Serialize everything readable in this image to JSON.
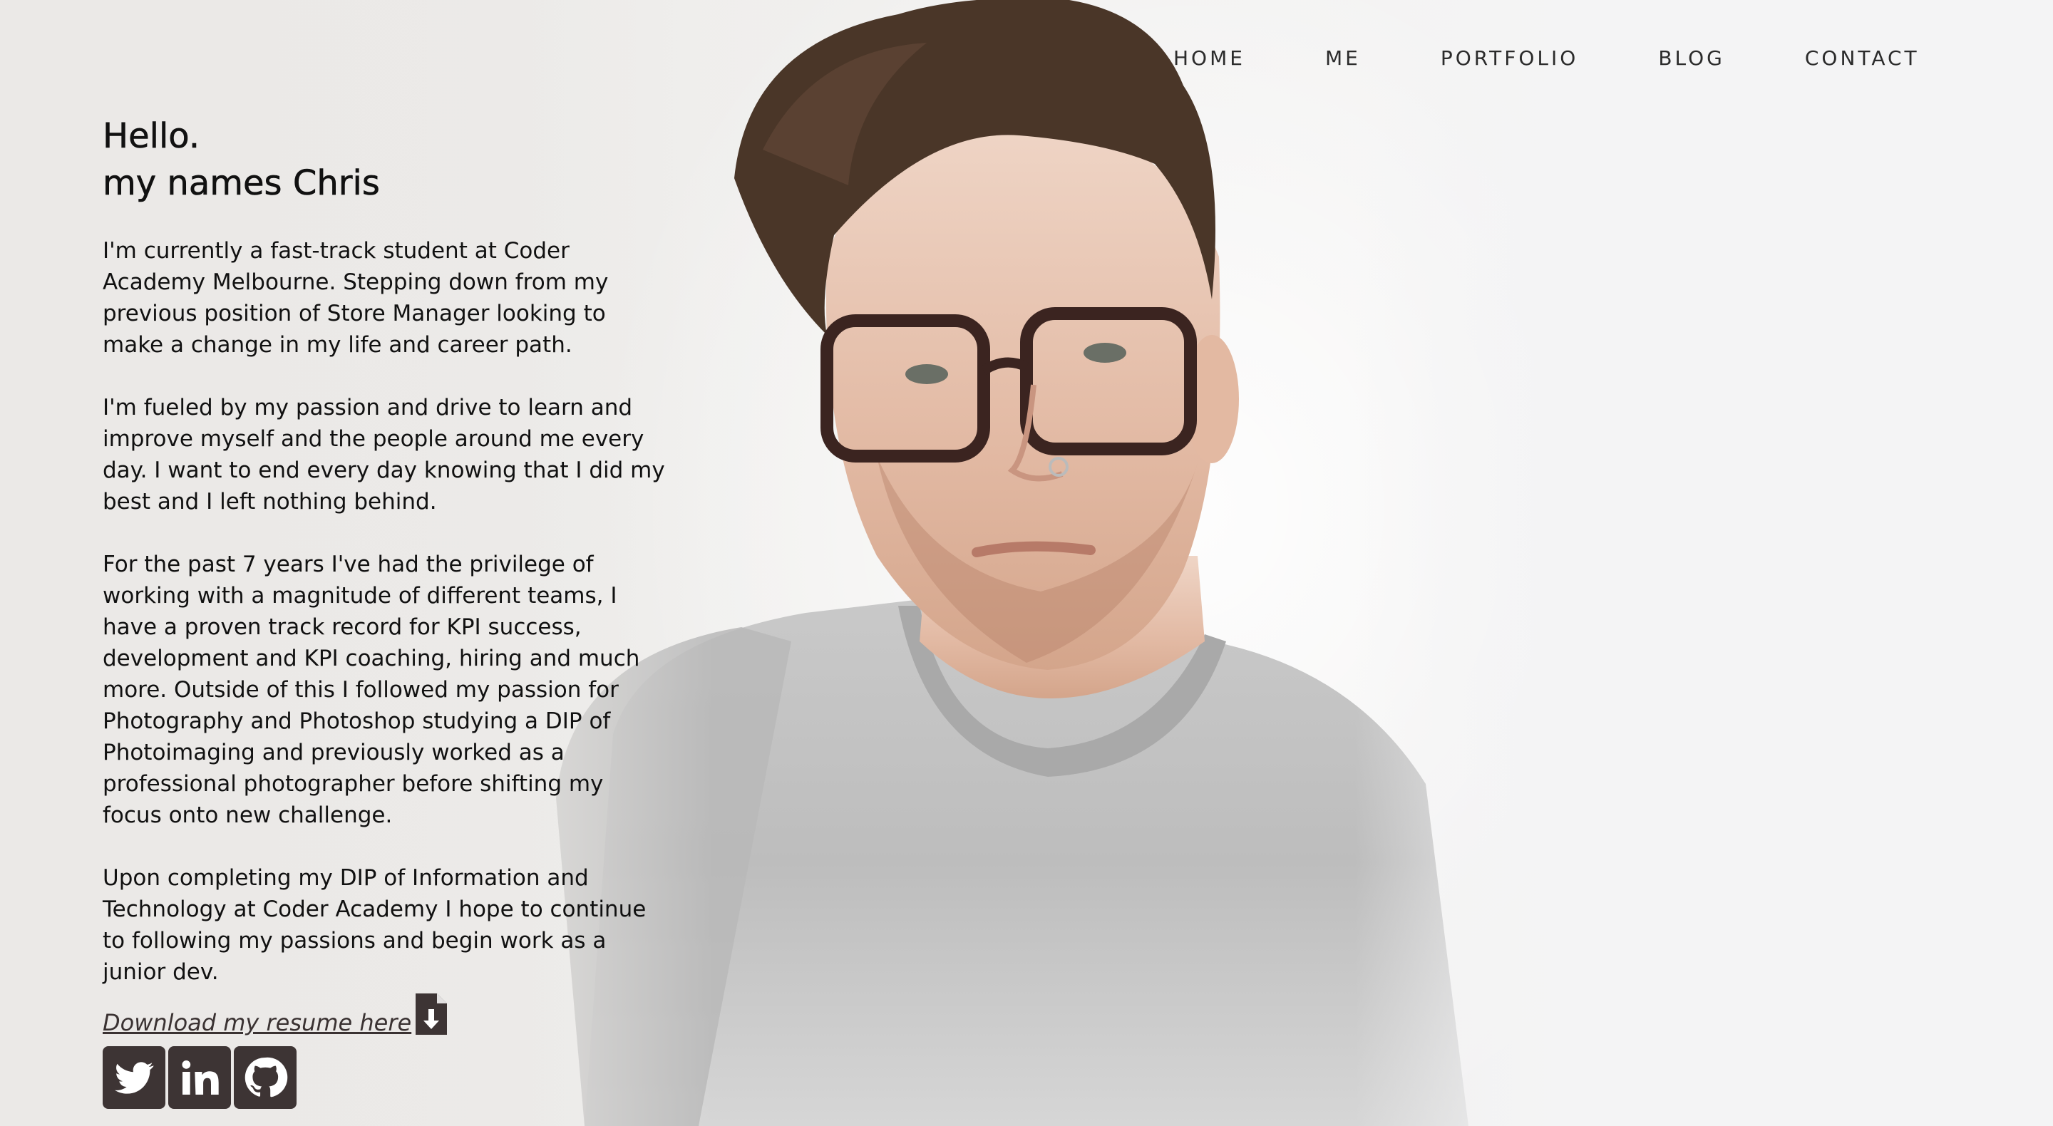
{
  "nav": {
    "items": [
      {
        "label": "HOME"
      },
      {
        "label": "ME"
      },
      {
        "label": "PORTFOLIO"
      },
      {
        "label": "BLOG"
      },
      {
        "label": "CONTACT"
      }
    ]
  },
  "intro": {
    "greeting": "Hello.",
    "name_line": "my names Chris",
    "paragraphs": [
      "I'm currently a fast-track student at Coder Academy Melbourne. Stepping down from my previous position of Store Manager looking to make a change in my life and career path.",
      "I'm fueled by my passion and drive to learn and improve myself and the people around me every day. I want to end every day knowing that I did my best and I left nothing behind.",
      "For the past 7 years I've had the privilege of working with a magnitude of different teams, I have a proven track record for KPI success, development and KPI coaching, hiring and much more. Outside of this I followed my passion for Photography and Photoshop studying a DIP of Photoimaging and previously worked as a professional photographer before shifting my focus onto new challenge.",
      "Upon completing my DIP of Information and Technology at Coder Academy I hope to continue to following my passions and begin work as a junior dev."
    ],
    "resume_link": "Download my resume here"
  },
  "icons": {
    "resume": "file-download-icon",
    "social": [
      "twitter-icon",
      "linkedin-icon",
      "github-icon"
    ]
  },
  "colors": {
    "icon_bg": "#3d3434",
    "text": "#111111",
    "link": "#3a3232"
  }
}
